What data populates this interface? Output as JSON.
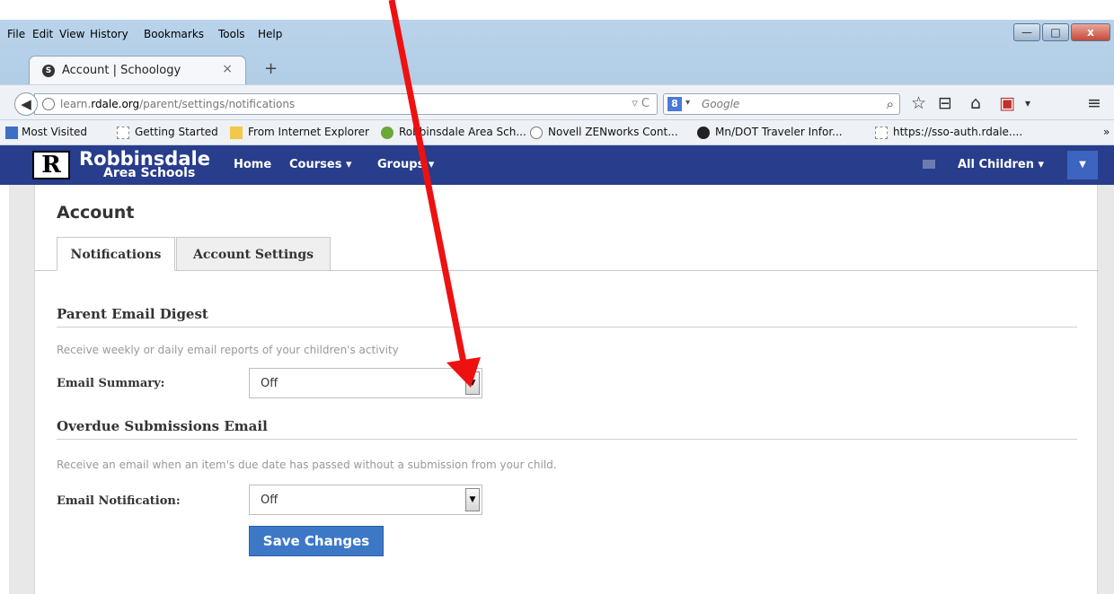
{
  "menu": [
    "File",
    "Edit",
    "View",
    "History",
    "Bookmarks",
    "Tools",
    "Help"
  ],
  "window_controls": {
    "minimize": "—",
    "maximize": "□",
    "close": "x"
  },
  "tab": {
    "favicon": "S",
    "title": "Account | Schoology",
    "close": "×",
    "new": "+"
  },
  "address": {
    "prefix": "learn.",
    "domain": "rdale.org",
    "path": "/parent/settings/notifications",
    "controls": "▿ C"
  },
  "search": {
    "engine_icon": "8",
    "placeholder": "Google"
  },
  "bookmarks": [
    "Most Visited",
    "Getting Started",
    "From Internet Explorer",
    "Robbinsdale Area Sch...",
    "Novell ZENworks Cont...",
    "Mn/DOT Traveler Infor...",
    "https://sso-auth.rdale...."
  ],
  "bookmarks_overflow": "»",
  "header": {
    "logo_mark": "R",
    "logo_line1": "Robbinsdale",
    "logo_line2": "Area Schools",
    "nav": [
      "Home",
      "Courses ▾",
      "Groups ▾"
    ],
    "children_menu": "All Children ▾",
    "dropdown_glyph": "▼"
  },
  "page": {
    "title": "Account",
    "tabs": [
      "Notifications",
      "Account Settings"
    ],
    "sections": [
      {
        "heading": "Parent Email Digest",
        "help": "Receive weekly or daily email reports of your children's activity",
        "field_label": "Email Summary:",
        "value": "Off"
      },
      {
        "heading": "Overdue Submissions Email",
        "help": "Receive an email when an item's due date has passed without a submission from your child.",
        "field_label": "Email Notification:",
        "value": "Off"
      }
    ],
    "save_label": "Save Changes"
  },
  "colors": {
    "header_bg": "#283d8c",
    "accent_button": "#3d78c7",
    "annotation_arrow": "#ee1111"
  }
}
